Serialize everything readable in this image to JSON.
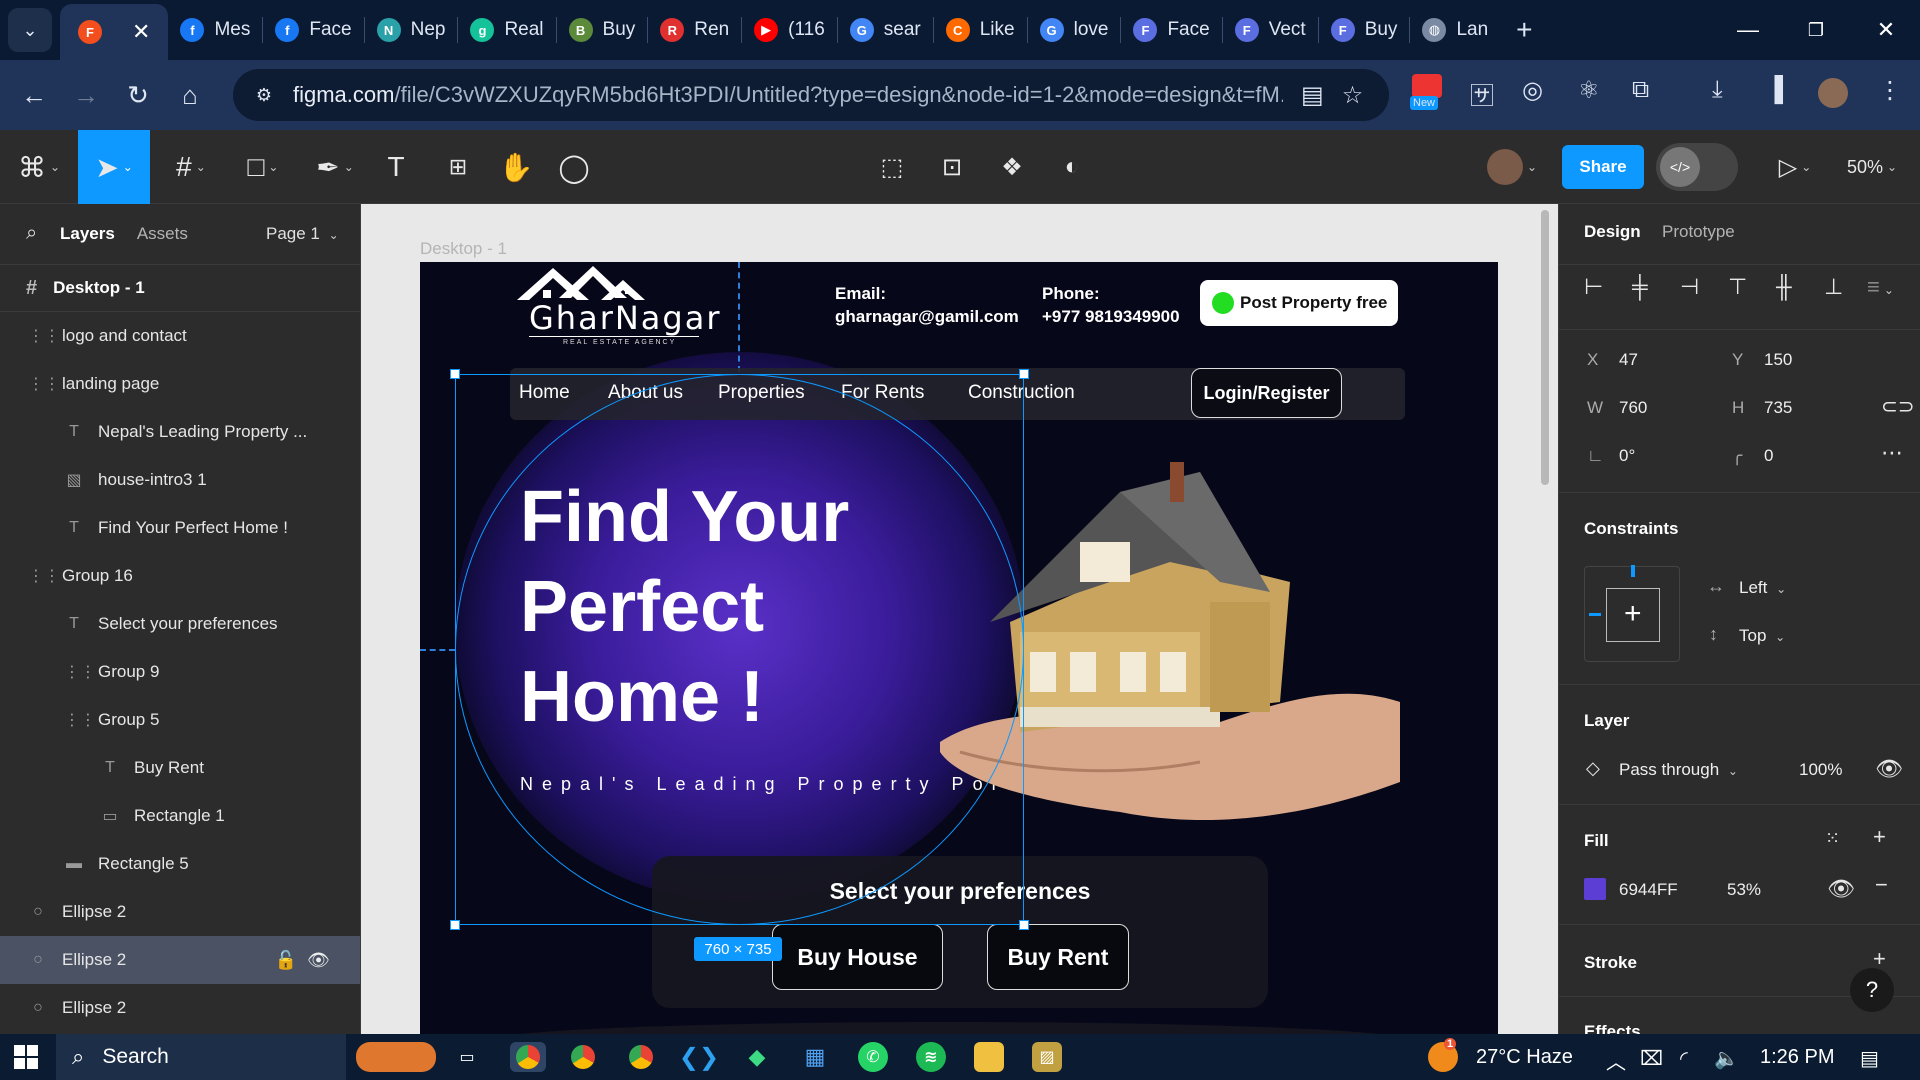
{
  "browser": {
    "tabs": [
      {
        "label": "",
        "icon": "figma-icon",
        "color": "#f24e1e",
        "glyph": "F",
        "active": true
      },
      {
        "label": "Mes",
        "icon": "facebook-icon",
        "color": "#1877f2",
        "glyph": "f"
      },
      {
        "label": "Face",
        "icon": "facebook-icon",
        "color": "#1877f2",
        "glyph": "f"
      },
      {
        "label": "Nep",
        "icon": "site-icon",
        "color": "#2aa0a8",
        "glyph": "N"
      },
      {
        "label": "Real",
        "icon": "grammarly-icon",
        "color": "#15c39a",
        "glyph": "g"
      },
      {
        "label": "Buy",
        "icon": "site-icon",
        "color": "#5a8a3a",
        "glyph": "B"
      },
      {
        "label": "Ren",
        "icon": "site-icon",
        "color": "#e03030",
        "glyph": "R"
      },
      {
        "label": "(116",
        "icon": "youtube-icon",
        "color": "#ff0000",
        "glyph": "▶"
      },
      {
        "label": "sear",
        "icon": "google-icon",
        "color": "#4285f4",
        "glyph": "G"
      },
      {
        "label": "Like",
        "icon": "site-icon",
        "color": "#ff6a00",
        "glyph": "C"
      },
      {
        "label": "love",
        "icon": "google-icon",
        "color": "#4285f4",
        "glyph": "G"
      },
      {
        "label": "Face",
        "icon": "site-icon",
        "color": "#5b6ee1",
        "glyph": "F"
      },
      {
        "label": "Vect",
        "icon": "site-icon",
        "color": "#5b6ee1",
        "glyph": "F"
      },
      {
        "label": "Buy",
        "icon": "site-icon",
        "color": "#5b6ee1",
        "glyph": "F"
      },
      {
        "label": "Lan",
        "icon": "globe-icon",
        "color": "#7a8aa3",
        "glyph": "◍"
      }
    ],
    "url_host": "figma.com",
    "url_rest": "/file/C3vWZXUZqyRM5bd6Ht3PDI/Untitled?type=design&node-id=1-2&mode=design&t=fM...",
    "new_badge": "New"
  },
  "toolbar": {
    "share_label": "Share",
    "zoom": "50%"
  },
  "layers_panel": {
    "tab_layers": "Layers",
    "tab_assets": "Assets",
    "page": "Page 1",
    "frame_name": "Desktop - 1",
    "items": [
      {
        "label": "logo and contact",
        "indent": 1,
        "icon": "group-icon",
        "glyph": "⋮⋮"
      },
      {
        "label": "landing page",
        "indent": 1,
        "icon": "group-icon",
        "glyph": "⋮⋮"
      },
      {
        "label": "Nepal's Leading Property ...",
        "indent": 2,
        "icon": "text-icon",
        "glyph": "T"
      },
      {
        "label": "house-intro3 1",
        "indent": 2,
        "icon": "image-icon",
        "glyph": "▧"
      },
      {
        "label": "Find Your Perfect Home !",
        "indent": 2,
        "icon": "text-icon",
        "glyph": "T"
      },
      {
        "label": "Group 16",
        "indent": 1,
        "icon": "group-icon",
        "glyph": "⋮⋮"
      },
      {
        "label": "Select your preferences",
        "indent": 2,
        "icon": "text-icon",
        "glyph": "T"
      },
      {
        "label": "Group 9",
        "indent": 2,
        "icon": "group-icon",
        "glyph": "⋮⋮"
      },
      {
        "label": "Group 5",
        "indent": 2,
        "icon": "group-icon",
        "glyph": "⋮⋮"
      },
      {
        "label": "Buy Rent",
        "indent": 3,
        "icon": "text-icon",
        "glyph": "T"
      },
      {
        "label": "Rectangle 1",
        "indent": 3,
        "icon": "rectangle-icon",
        "glyph": "▭"
      },
      {
        "label": "Rectangle 5",
        "indent": 2,
        "icon": "rectangle-icon",
        "glyph": "▬"
      },
      {
        "label": "Ellipse 2",
        "indent": 1,
        "icon": "ellipse-icon",
        "glyph": "○"
      },
      {
        "label": "Ellipse 2",
        "indent": 1,
        "icon": "ellipse-icon",
        "glyph": "○",
        "selected": true
      },
      {
        "label": "Ellipse 2",
        "indent": 1,
        "icon": "ellipse-icon",
        "glyph": "○"
      }
    ]
  },
  "canvas": {
    "frame_label": "Desktop - 1",
    "selection_size": "760 × 735"
  },
  "site": {
    "logo_text": "GharNagar",
    "logo_tagline": "REAL ESTATE AGENCY",
    "email_label": "Email:",
    "email_value": "gharnagar@gamil.com",
    "phone_label": "Phone:",
    "phone_value": "+977 9819349900",
    "post_button": "Post Property free",
    "nav": [
      "Home",
      "About us",
      "Properties",
      "For Rents",
      "Construction"
    ],
    "login_button": "Login/Register",
    "hero_line1": "Find Your",
    "hero_line2": "Perfect",
    "hero_line3": "Home !",
    "subtitle": "Nepal's Leading Property Portal",
    "pref_title": "Select your preferences",
    "buy_house": "Buy House",
    "buy_rent": "Buy Rent"
  },
  "design_panel": {
    "tab_design": "Design",
    "tab_prototype": "Prototype",
    "x_label": "X",
    "x": "47",
    "y_label": "Y",
    "y": "150",
    "w_label": "W",
    "w": "760",
    "h_label": "H",
    "h": "735",
    "rotation": "0°",
    "radius": "0",
    "constraints_title": "Constraints",
    "constraint_h": "Left",
    "constraint_v": "Top",
    "layer_title": "Layer",
    "blend": "Pass through",
    "opacity": "100%",
    "fill_title": "Fill",
    "fill_hex": "6944FF",
    "fill_opacity": "53%",
    "fill_color": "#6944ff",
    "stroke_title": "Stroke",
    "effects_title": "Effects"
  },
  "taskbar": {
    "search": "Search",
    "weather": "27°C  Haze",
    "time": "1:26 PM",
    "notification_count": "1"
  }
}
